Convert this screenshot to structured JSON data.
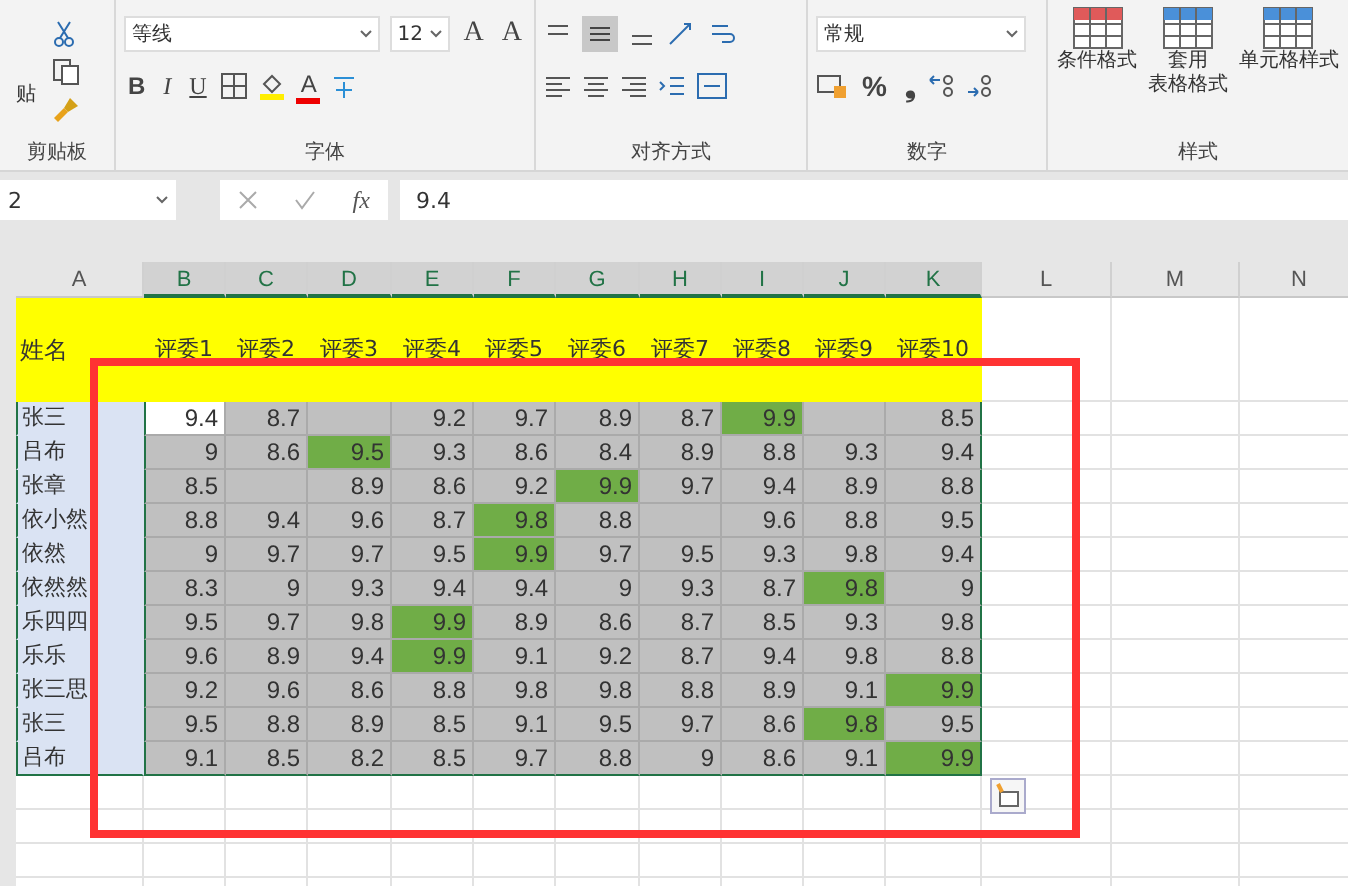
{
  "ribbon": {
    "clipboard": {
      "paste": "贴",
      "label": "剪贴板"
    },
    "font": {
      "font_name": "等线",
      "font_size": "12",
      "grow": "A",
      "shrink": "A",
      "bold": "B",
      "italic": "I",
      "underline": "U",
      "font_color": "A",
      "label": "字体"
    },
    "alignment": {
      "label": "对齐方式"
    },
    "number": {
      "format": "常规",
      "percent": "%",
      "comma": "❟",
      "label": "数字"
    },
    "styles": {
      "buttons": [
        {
          "lines": [
            "条件格式"
          ]
        },
        {
          "lines": [
            "套用",
            "表格格式"
          ]
        },
        {
          "lines": [
            "单元格样式"
          ]
        }
      ],
      "label": "样式"
    }
  },
  "formula_bar": {
    "name_box": "2",
    "fx": "fx",
    "value": "9.4"
  },
  "columns": [
    "A",
    "B",
    "C",
    "D",
    "E",
    "F",
    "G",
    "H",
    "I",
    "J",
    "K",
    "L",
    "M",
    "N"
  ],
  "header_row": {
    "name": "姓名",
    "judges": [
      "评委1",
      "评委2",
      "评委3",
      "评委4",
      "评委5",
      "评委6",
      "评委7",
      "评委8",
      "评委9",
      "评委10"
    ]
  },
  "rows": [
    {
      "name": "张三",
      "scores": [
        {
          "value": "9.4",
          "highlighted": false,
          "selected": true
        },
        {
          "value": "8.7",
          "highlighted": false,
          "selected": false
        },
        {
          "highlighted": false,
          "selected": false
        },
        {
          "value": "9.2",
          "highlighted": false,
          "selected": false
        },
        {
          "value": "9.7",
          "highlighted": false,
          "selected": false
        },
        {
          "value": "8.9",
          "highlighted": false,
          "selected": false
        },
        {
          "value": "8.7",
          "highlighted": false,
          "selected": false
        },
        {
          "value": "9.9",
          "highlighted": true,
          "selected": false
        },
        {
          "highlighted": false,
          "selected": false
        },
        {
          "value": "8.5",
          "highlighted": false,
          "selected": false
        }
      ]
    },
    {
      "name": "吕布",
      "scores": [
        {
          "value": "9",
          "highlighted": false,
          "selected": false
        },
        {
          "value": "8.6",
          "highlighted": false,
          "selected": false
        },
        {
          "value": "9.5",
          "highlighted": true,
          "selected": false
        },
        {
          "value": "9.3",
          "highlighted": false,
          "selected": false
        },
        {
          "value": "8.6",
          "highlighted": false,
          "selected": false
        },
        {
          "value": "8.4",
          "highlighted": false,
          "selected": false
        },
        {
          "value": "8.9",
          "highlighted": false,
          "selected": false
        },
        {
          "value": "8.8",
          "highlighted": false,
          "selected": false
        },
        {
          "value": "9.3",
          "highlighted": false,
          "selected": false
        },
        {
          "value": "9.4",
          "highlighted": false,
          "selected": false
        }
      ]
    },
    {
      "name": "张章",
      "scores": [
        {
          "value": "8.5",
          "highlighted": false,
          "selected": false
        },
        {
          "highlighted": false,
          "selected": false
        },
        {
          "value": "8.9",
          "highlighted": false,
          "selected": false
        },
        {
          "value": "8.6",
          "highlighted": false,
          "selected": false
        },
        {
          "value": "9.2",
          "highlighted": false,
          "selected": false
        },
        {
          "value": "9.9",
          "highlighted": true,
          "selected": false
        },
        {
          "value": "9.7",
          "highlighted": false,
          "selected": false
        },
        {
          "value": "9.4",
          "highlighted": false,
          "selected": false
        },
        {
          "value": "8.9",
          "highlighted": false,
          "selected": false
        },
        {
          "value": "8.8",
          "highlighted": false,
          "selected": false
        }
      ]
    },
    {
      "name": "依小然",
      "scores": [
        {
          "value": "8.8",
          "highlighted": false,
          "selected": false
        },
        {
          "value": "9.4",
          "highlighted": false,
          "selected": false
        },
        {
          "value": "9.6",
          "highlighted": false,
          "selected": false
        },
        {
          "value": "8.7",
          "highlighted": false,
          "selected": false
        },
        {
          "value": "9.8",
          "highlighted": true,
          "selected": false
        },
        {
          "value": "8.8",
          "highlighted": false,
          "selected": false
        },
        {
          "highlighted": false,
          "selected": false
        },
        {
          "value": "9.6",
          "highlighted": false,
          "selected": false
        },
        {
          "value": "8.8",
          "highlighted": false,
          "selected": false
        },
        {
          "value": "9.5",
          "highlighted": false,
          "selected": false
        }
      ]
    },
    {
      "name": "依然",
      "scores": [
        {
          "value": "9",
          "highlighted": false,
          "selected": false
        },
        {
          "value": "9.7",
          "highlighted": false,
          "selected": false
        },
        {
          "value": "9.7",
          "highlighted": false,
          "selected": false
        },
        {
          "value": "9.5",
          "highlighted": false,
          "selected": false
        },
        {
          "value": "9.9",
          "highlighted": true,
          "selected": false
        },
        {
          "value": "9.7",
          "highlighted": false,
          "selected": false
        },
        {
          "value": "9.5",
          "highlighted": false,
          "selected": false
        },
        {
          "value": "9.3",
          "highlighted": false,
          "selected": false
        },
        {
          "value": "9.8",
          "highlighted": false,
          "selected": false
        },
        {
          "value": "9.4",
          "highlighted": false,
          "selected": false
        }
      ]
    },
    {
      "name": "依然然",
      "scores": [
        {
          "value": "8.3",
          "highlighted": false,
          "selected": false
        },
        {
          "value": "9",
          "highlighted": false,
          "selected": false
        },
        {
          "value": "9.3",
          "highlighted": false,
          "selected": false
        },
        {
          "value": "9.4",
          "highlighted": false,
          "selected": false
        },
        {
          "value": "9.4",
          "highlighted": false,
          "selected": false
        },
        {
          "value": "9",
          "highlighted": false,
          "selected": false
        },
        {
          "value": "9.3",
          "highlighted": false,
          "selected": false
        },
        {
          "value": "8.7",
          "highlighted": false,
          "selected": false
        },
        {
          "value": "9.8",
          "highlighted": true,
          "selected": false
        },
        {
          "value": "9",
          "highlighted": false,
          "selected": false
        }
      ]
    },
    {
      "name": "乐四四",
      "scores": [
        {
          "value": "9.5",
          "highlighted": false,
          "selected": false
        },
        {
          "value": "9.7",
          "highlighted": false,
          "selected": false
        },
        {
          "value": "9.8",
          "highlighted": false,
          "selected": false
        },
        {
          "value": "9.9",
          "highlighted": true,
          "selected": false
        },
        {
          "value": "8.9",
          "highlighted": false,
          "selected": false
        },
        {
          "value": "8.6",
          "highlighted": false,
          "selected": false
        },
        {
          "value": "8.7",
          "highlighted": false,
          "selected": false
        },
        {
          "value": "8.5",
          "highlighted": false,
          "selected": false
        },
        {
          "value": "9.3",
          "highlighted": false,
          "selected": false
        },
        {
          "value": "9.8",
          "highlighted": false,
          "selected": false
        }
      ]
    },
    {
      "name": "乐乐",
      "scores": [
        {
          "value": "9.6",
          "highlighted": false,
          "selected": false
        },
        {
          "value": "8.9",
          "highlighted": false,
          "selected": false
        },
        {
          "value": "9.4",
          "highlighted": false,
          "selected": false
        },
        {
          "value": "9.9",
          "highlighted": true,
          "selected": false
        },
        {
          "value": "9.1",
          "highlighted": false,
          "selected": false
        },
        {
          "value": "9.2",
          "highlighted": false,
          "selected": false
        },
        {
          "value": "8.7",
          "highlighted": false,
          "selected": false
        },
        {
          "value": "9.4",
          "highlighted": false,
          "selected": false
        },
        {
          "value": "9.8",
          "highlighted": false,
          "selected": false
        },
        {
          "value": "8.8",
          "highlighted": false,
          "selected": false
        }
      ]
    },
    {
      "name": "张三思",
      "scores": [
        {
          "value": "9.2",
          "highlighted": false,
          "selected": false
        },
        {
          "value": "9.6",
          "highlighted": false,
          "selected": false
        },
        {
          "value": "8.6",
          "highlighted": false,
          "selected": false
        },
        {
          "value": "8.8",
          "highlighted": false,
          "selected": false
        },
        {
          "value": "9.8",
          "highlighted": false,
          "selected": false
        },
        {
          "value": "9.8",
          "highlighted": false,
          "selected": false
        },
        {
          "value": "8.8",
          "highlighted": false,
          "selected": false
        },
        {
          "value": "8.9",
          "highlighted": false,
          "selected": false
        },
        {
          "value": "9.1",
          "highlighted": false,
          "selected": false
        },
        {
          "value": "9.9",
          "highlighted": true,
          "selected": false
        }
      ]
    },
    {
      "name": "张三",
      "scores": [
        {
          "value": "9.5",
          "highlighted": false,
          "selected": false
        },
        {
          "value": "8.8",
          "highlighted": false,
          "selected": false
        },
        {
          "value": "8.9",
          "highlighted": false,
          "selected": false
        },
        {
          "value": "8.5",
          "highlighted": false,
          "selected": false
        },
        {
          "value": "9.1",
          "highlighted": false,
          "selected": false
        },
        {
          "value": "9.5",
          "highlighted": false,
          "selected": false
        },
        {
          "value": "9.7",
          "highlighted": false,
          "selected": false
        },
        {
          "value": "8.6",
          "highlighted": false,
          "selected": false
        },
        {
          "value": "9.8",
          "highlighted": true,
          "selected": false
        },
        {
          "value": "9.5",
          "highlighted": false,
          "selected": false
        }
      ]
    },
    {
      "name": "吕布",
      "scores": [
        {
          "value": "9.1",
          "highlighted": false,
          "selected": false
        },
        {
          "value": "8.5",
          "highlighted": false,
          "selected": false
        },
        {
          "value": "8.2",
          "highlighted": false,
          "selected": false
        },
        {
          "value": "8.5",
          "highlighted": false,
          "selected": false
        },
        {
          "value": "9.7",
          "highlighted": false,
          "selected": false
        },
        {
          "value": "8.8",
          "highlighted": false,
          "selected": false
        },
        {
          "value": "9",
          "highlighted": false,
          "selected": false
        },
        {
          "value": "8.6",
          "highlighted": false,
          "selected": false
        },
        {
          "value": "9.1",
          "highlighted": false,
          "selected": false
        },
        {
          "value": "9.9",
          "highlighted": true,
          "selected": false
        }
      ]
    }
  ]
}
